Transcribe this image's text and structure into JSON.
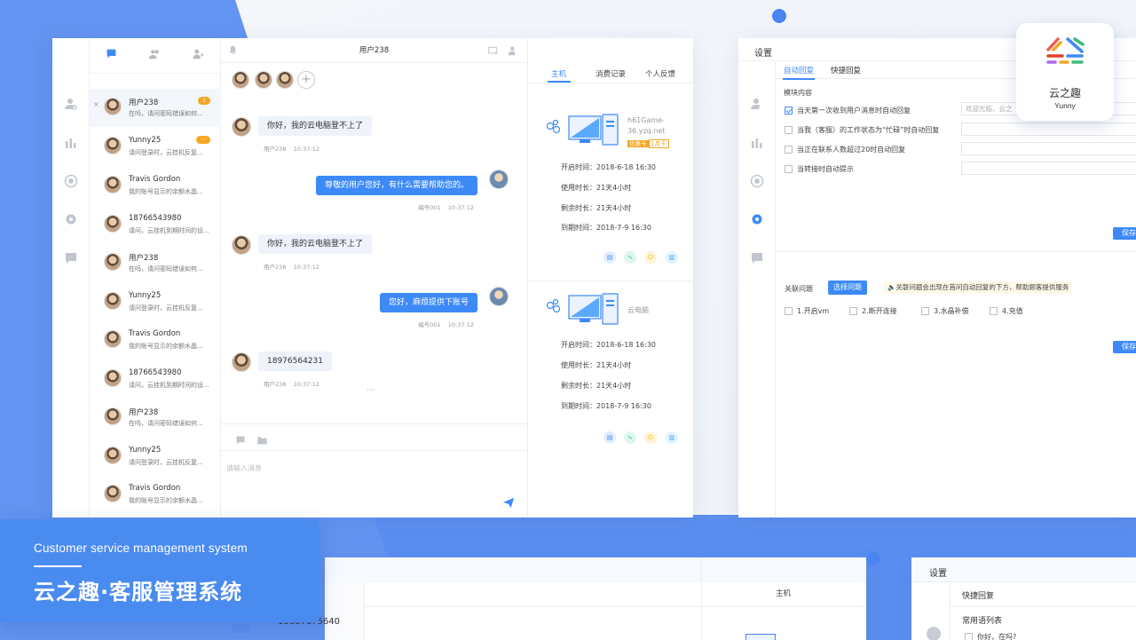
{
  "brand": {
    "logo_cn": "云之趣",
    "logo_en": "Yunny",
    "subtitle_en": "Customer service management system",
    "title_cn": "云之趣·客服管理系统"
  },
  "chat_window": {
    "header_title": "用户238",
    "contact_tabs": [
      "chat-icon",
      "group-icon",
      "user-add-icon"
    ],
    "contacts": [
      {
        "name": "用户238",
        "msg": "在吗，请问密码错误如何...",
        "badge": "1",
        "selected": true
      },
      {
        "name": "Yunny25",
        "msg": "请问登录时，云挂机反复...",
        "badge": "···"
      },
      {
        "name": "Travis Gordon",
        "msg": "我的账号显示的余额水晶...",
        "badge": ""
      },
      {
        "name": "18766543980",
        "msg": "请问，云挂机到期时间的设...",
        "badge": ""
      },
      {
        "name": "用户238",
        "msg": "在吗，请问密码错误如何...",
        "badge": ""
      },
      {
        "name": "Yunny25",
        "msg": "请问登录时，云挂机反复...",
        "badge": ""
      },
      {
        "name": "Travis Gordon",
        "msg": "我的账号显示的余额水晶...",
        "badge": ""
      },
      {
        "name": "18766543980",
        "msg": "请问，云挂机到期时间的设...",
        "badge": ""
      },
      {
        "name": "用户238",
        "msg": "在吗，请问密码错误如何...",
        "badge": ""
      },
      {
        "name": "Yunny25",
        "msg": "请问登录时，云挂机反复...",
        "badge": ""
      },
      {
        "name": "Travis Gordon",
        "msg": "我的账号显示的余额水晶...",
        "badge": ""
      }
    ],
    "messages": [
      {
        "side": "left",
        "text": "你好，我的云电脑登不上了",
        "sender": "用户238",
        "time": "10:37:12"
      },
      {
        "side": "right",
        "text": "尊敬的用户您好，有什么需要帮助您的。",
        "sender": "编号001",
        "time": "10:37:12"
      },
      {
        "side": "left",
        "text": "你好，我的云电脑登不上了",
        "sender": "用户238",
        "time": "10:37:12"
      },
      {
        "side": "right",
        "text": "您好，麻烦提供下账号",
        "sender": "编号001",
        "time": "10:37:12"
      },
      {
        "side": "left",
        "text": "18976564231",
        "sender": "用户238",
        "time": "10:37:12"
      }
    ],
    "more": "···",
    "input_placeholder": "请输入消息",
    "host_tabs": [
      "主机",
      "消费记录",
      "个人反馈"
    ],
    "hosts": [
      {
        "name": "h61Game-36.yzq.net",
        "name_line1": "h61Game-",
        "name_line2": "36.yzq.net",
        "tags": [
          "优惠卡",
          "1月卡"
        ],
        "start_label": "开启时间：",
        "start": "2018-6-18 16:30",
        "used_label": "使用时长：",
        "used": "21天4小时",
        "left_label": "剩余时长：",
        "left": "21天4小时",
        "expire_label": "到期时间：",
        "expire": "2018-7-9 16:30"
      },
      {
        "name": "云电脑",
        "start_label": "开启时间：",
        "start": "2018-6-18 16:30",
        "used_label": "使用时长：",
        "used": "21天4小时",
        "left_label": "剩余时长：",
        "left": "21天4小时",
        "expire_label": "到期时间：",
        "expire": "2018-7-9 16:30"
      }
    ],
    "colors": {
      "accent": "#3d8af7",
      "badge": "#f5a623"
    }
  },
  "settings_window": {
    "title": "设置",
    "tabs": [
      "自动回复",
      "快捷回复"
    ],
    "section_label": "模块内容",
    "rules": [
      {
        "label": "当天第一次收到用户消息时自动回复",
        "checked": true
      },
      {
        "label": "当我（客服）的工作状态为“忙碌”时自动回复",
        "checked": false
      },
      {
        "label": "当正在联系人数超过20时自动回复",
        "checked": false
      },
      {
        "label": "当转接时自动提示",
        "checked": false
      }
    ],
    "input_value": "欢迎光临，云之",
    "save_label": "保存",
    "related_label": "关联问题",
    "select_button": "选择问题",
    "related_hint": "关联问题会出现在首问自动回复的下方，帮助顾客提供服务",
    "questions": [
      "1.开启vm",
      "2.断开连接",
      "3.水晶补偿",
      "4.充值"
    ]
  },
  "bottom_windows": {
    "host_tab": "主机",
    "phone": "15387675640",
    "settings_title": "设置",
    "quick_reply": "快捷回复",
    "phrase_list": "常用语列表",
    "phrase_preview": "你好，在吗?"
  }
}
